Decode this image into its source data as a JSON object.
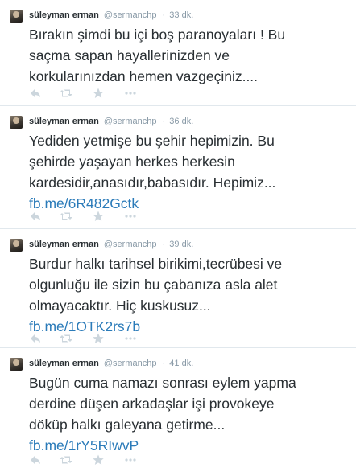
{
  "tweets": [
    {
      "name": "süleyman erman",
      "handle": "@sermanchp",
      "separator": "·",
      "time": "33 dk.",
      "lines": [
        "Bırakın şimdi bu içi boş paranoyaları ! Bu",
        "saçma sapan hayallerinizden ve",
        "korkularınızdan hemen vazgeçiniz...."
      ],
      "link": ""
    },
    {
      "name": "süleyman erman",
      "handle": "@sermanchp",
      "separator": "·",
      "time": "36 dk.",
      "lines": [
        "Yediden yetmişe bu şehir hepimizin. Bu",
        "şehirde yaşayan herkes herkesin",
        "kardesidir,anasıdır,babasıdır. Hepimiz..."
      ],
      "link": "fb.me/6R482Gctk"
    },
    {
      "name": "süleyman erman",
      "handle": "@sermanchp",
      "separator": "·",
      "time": "39 dk.",
      "lines": [
        "Burdur halkı tarihsel birikimi,tecrübesi ve",
        "olgunluğu ile sizin bu çabanıza  asla alet",
        "olmayacaktır. Hiç kuskusuz..."
      ],
      "link": "fb.me/1OTK2rs7b"
    },
    {
      "name": "süleyman erman",
      "handle": "@sermanchp",
      "separator": "·",
      "time": "41 dk.",
      "lines": [
        "Bugün cuma namazı sonrası eylem yapma",
        "derdine düşen arkadaşlar işi provokeye",
        "döküp halkı galeyana  getirme..."
      ],
      "link": "fb.me/1rY5RIwvP"
    }
  ],
  "icons": [
    "reply-icon",
    "retweet-icon",
    "favorite-icon",
    "more-icon"
  ],
  "colors": {
    "text": "#292f33",
    "meta": "#8899a6",
    "link": "#2b7bb9",
    "icon": "#ccd6dd",
    "divider": "#e1e8ed"
  }
}
